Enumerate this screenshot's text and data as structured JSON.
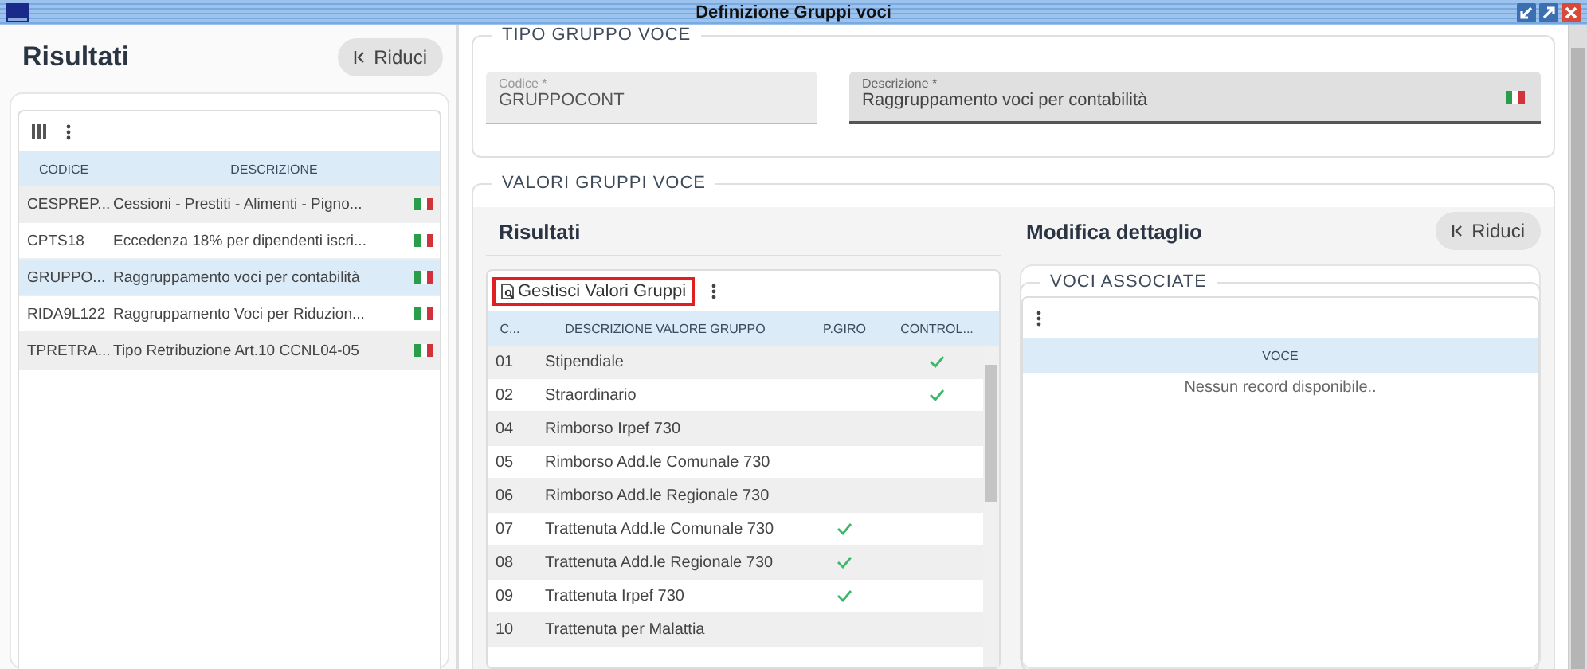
{
  "window": {
    "title": "Definizione Gruppi voci"
  },
  "left_panel": {
    "title": "Risultati",
    "collapse_button": "Riduci",
    "table": {
      "columns": [
        "CODICE",
        "DESCRIZIONE"
      ],
      "rows": [
        {
          "code": "CESPREP...",
          "description": "Cessioni - Prestiti - Alimenti - Pigno...",
          "selected": false
        },
        {
          "code": "CPTS18",
          "description": "Eccedenza 18% per dipendenti iscri...",
          "selected": false
        },
        {
          "code": "GRUPPO...",
          "description": "Raggruppamento voci per contabilità",
          "selected": true
        },
        {
          "code": "RIDA9L122",
          "description": "Raggruppamento Voci per Riduzion...",
          "selected": false
        },
        {
          "code": "TPRETRA...",
          "description": "Tipo Retribuzione Art.10 CCNL04-05",
          "selected": false
        }
      ]
    }
  },
  "tipo_gruppo": {
    "legend": "TIPO GRUPPO VOCE",
    "fields": [
      {
        "label": "Codice *",
        "value": "GRUPPOCONT",
        "disabled": true
      },
      {
        "label": "Descrizione *",
        "value": "Raggruppamento voci per contabilità",
        "disabled": false
      }
    ]
  },
  "valori_gruppi": {
    "legend": "VALORI GRUPPI VOCE",
    "results": {
      "title": "Risultati",
      "toolbar_button": "Gestisci Valori Gruppi",
      "columns": [
        "C...",
        "DESCRIZIONE VALORE GRUPPO",
        "P.GIRO",
        "CONTROL..."
      ],
      "rows": [
        {
          "code": "01",
          "description": "Stipendiale",
          "p_giro": false,
          "controllo": true
        },
        {
          "code": "02",
          "description": "Straordinario",
          "p_giro": false,
          "controllo": true
        },
        {
          "code": "04",
          "description": "Rimborso Irpef 730",
          "p_giro": false,
          "controllo": false
        },
        {
          "code": "05",
          "description": "Rimborso Add.le Comunale 730",
          "p_giro": false,
          "controllo": false
        },
        {
          "code": "06",
          "description": "Rimborso Add.le Regionale 730",
          "p_giro": false,
          "controllo": false
        },
        {
          "code": "07",
          "description": "Trattenuta Add.le Comunale 730",
          "p_giro": true,
          "controllo": false
        },
        {
          "code": "08",
          "description": "Trattenuta Add.le Regionale 730",
          "p_giro": true,
          "controllo": false
        },
        {
          "code": "09",
          "description": "Trattenuta Irpef 730",
          "p_giro": true,
          "controllo": false
        },
        {
          "code": "10",
          "description": "Trattenuta per Malattia",
          "p_giro": false,
          "controllo": false
        }
      ]
    },
    "detail": {
      "title": "Modifica dettaglio",
      "collapse_button": "Riduci",
      "legend": "VOCI ASSOCIATE",
      "columns": [
        "VOCE"
      ],
      "empty_message": "Nessun record disponibile.."
    }
  }
}
